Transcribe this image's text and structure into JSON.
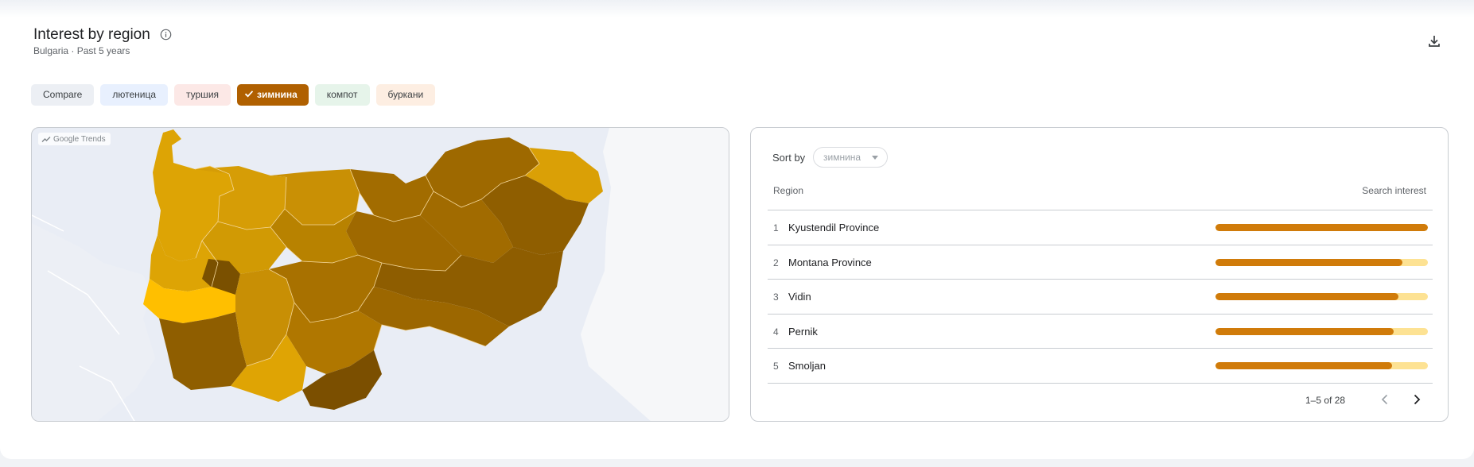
{
  "header": {
    "title": "Interest by region",
    "subtitle": "Bulgaria · Past 5 years",
    "info_icon": "info-icon",
    "download_icon": "download-icon"
  },
  "chips": [
    {
      "label": "Compare",
      "color": "#eceff4",
      "selected": false
    },
    {
      "label": "лютеница",
      "color": "#e8f0fe",
      "selected": false
    },
    {
      "label": "туршия",
      "color": "#fce8e6",
      "selected": false
    },
    {
      "label": "зимнина",
      "color": "#b06000",
      "selected": true
    },
    {
      "label": "компот",
      "color": "#e6f4ea",
      "selected": false
    },
    {
      "label": "буркани",
      "color": "#fdeee2",
      "selected": false
    }
  ],
  "map": {
    "badge": "Google Trends",
    "water_color": "#e9edf5"
  },
  "table": {
    "sort_label": "Sort by",
    "sort_value": "зимнина",
    "col_region": "Region",
    "col_interest": "Search interest",
    "rows": [
      {
        "rank": "1",
        "region": "Kyustendil Province",
        "interest": 100
      },
      {
        "rank": "2",
        "region": "Montana Province",
        "interest": 88
      },
      {
        "rank": "3",
        "region": "Vidin",
        "interest": 86
      },
      {
        "rank": "4",
        "region": "Pernik",
        "interest": 84
      },
      {
        "rank": "5",
        "region": "Smoljan",
        "interest": 83
      }
    ],
    "pager": "1–5 of 28",
    "bar_color": "#d07b0a",
    "bar_track_color": "#fde293"
  }
}
